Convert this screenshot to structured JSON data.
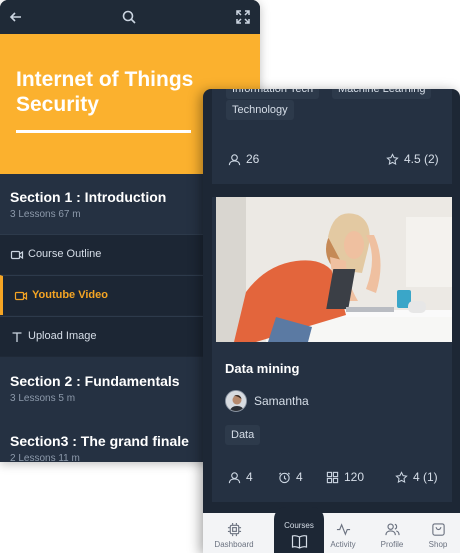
{
  "player": {
    "course_title": "Internet of Things Security",
    "sections": [
      {
        "title": "Section 1 : Introduction",
        "meta": "3 Lessons   67 m"
      },
      {
        "title": "Section 2 : Fundamentals",
        "meta": "3 Lessons   5 m"
      },
      {
        "title": "Section3 : The grand finale",
        "meta": "2 Lessons   11 m"
      }
    ],
    "lessons": [
      {
        "label": "Course Outline",
        "icon": "video-icon"
      },
      {
        "label": "Youtube Video",
        "icon": "video-icon",
        "active": true
      },
      {
        "label": "Upload Image",
        "icon": "text-icon"
      }
    ]
  },
  "list": {
    "card1": {
      "tags": [
        "Information Tech",
        "Machine Learning",
        "Technology"
      ],
      "students": "26",
      "rating": "4.5 (2)"
    },
    "card2": {
      "title": "Data mining",
      "author": "Samantha",
      "tag": "Data",
      "students": "4",
      "duration": "4",
      "lessons": "120",
      "rating": "4 (1)"
    }
  },
  "tabs": {
    "dashboard": "Dashboard",
    "courses": "Courses",
    "activity": "Activity",
    "profile": "Profile",
    "shop": "Shop"
  },
  "colors": {
    "accent": "#f5a524",
    "hero": "#fbb12e",
    "panel": "#1f2937"
  }
}
